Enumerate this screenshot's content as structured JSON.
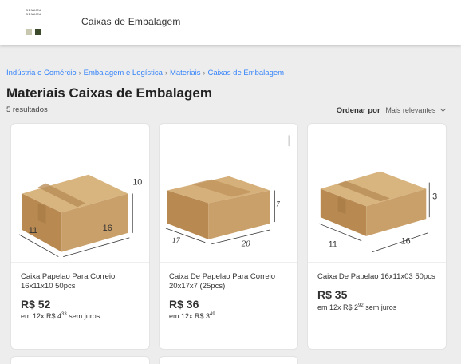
{
  "header": {
    "logo_lines": [
      "DENAMU",
      "DENAMU"
    ],
    "store_name": "Caixas de Embalagem"
  },
  "breadcrumb": [
    "Indústria e Comércio",
    "Embalagem e Logística",
    "Materiais",
    "Caixas de Embalagem"
  ],
  "page_title": "Materiais Caixas de Embalagem",
  "results_count": "5 resultados",
  "sort": {
    "label": "Ordenar por",
    "value": "Mais relevantes"
  },
  "products": [
    {
      "name": "Caixa Papelao Para Correio 16x11x10 50pcs",
      "price": "R$ 52",
      "installment_prefix": "em 12x R$ 4",
      "installment_cents": "33",
      "installment_suffix": " sem juros",
      "dims": [
        "11",
        "16",
        "10"
      ]
    },
    {
      "name": "Caixa De Papelao Para Correio 20x17x7 (25pcs)",
      "price": "R$ 36",
      "installment_prefix": "em 12x R$ 3",
      "installment_cents": "49",
      "installment_suffix": "",
      "dims": [
        "17",
        "20",
        "7"
      ]
    },
    {
      "name": "Caixa De Papelao 16x11x03 50pcs",
      "price": "R$ 35",
      "installment_prefix": "em 12x R$ 2",
      "installment_cents": "92",
      "installment_suffix": " sem juros",
      "dims": [
        "11",
        "16",
        "3"
      ]
    }
  ],
  "colors": {
    "link": "#3483fa",
    "cardboard": "#c9a36e",
    "background": "#ededed"
  }
}
